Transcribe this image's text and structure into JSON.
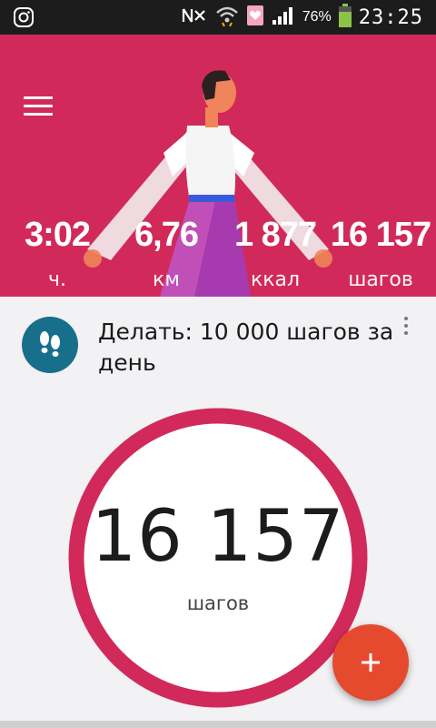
{
  "status_bar": {
    "battery_percent": "76%",
    "time": "23:25",
    "icons": [
      "instagram-icon",
      "nfc-mute-icon",
      "wifi-icon",
      "notification-icon",
      "signal-icon",
      "battery-icon"
    ]
  },
  "header": {
    "menu_icon": "menu-icon",
    "background_color": "#d12a5a",
    "stats": [
      {
        "value": "3:02",
        "unit": "ч."
      },
      {
        "value": "6,76",
        "unit": "км"
      },
      {
        "value": "1 877",
        "unit": "ккал"
      },
      {
        "value": "16 157",
        "unit": "шагов"
      }
    ]
  },
  "goal": {
    "icon": "footprints-icon",
    "text": "Делать: 10 000 шагов за день",
    "more_icon": "more-vert-icon"
  },
  "progress": {
    "count": "16 157",
    "unit": "шагов",
    "ring_color": "#d12a5a",
    "fraction": 1.0
  },
  "fab": {
    "icon": "add-icon",
    "color": "#e64a2e"
  }
}
